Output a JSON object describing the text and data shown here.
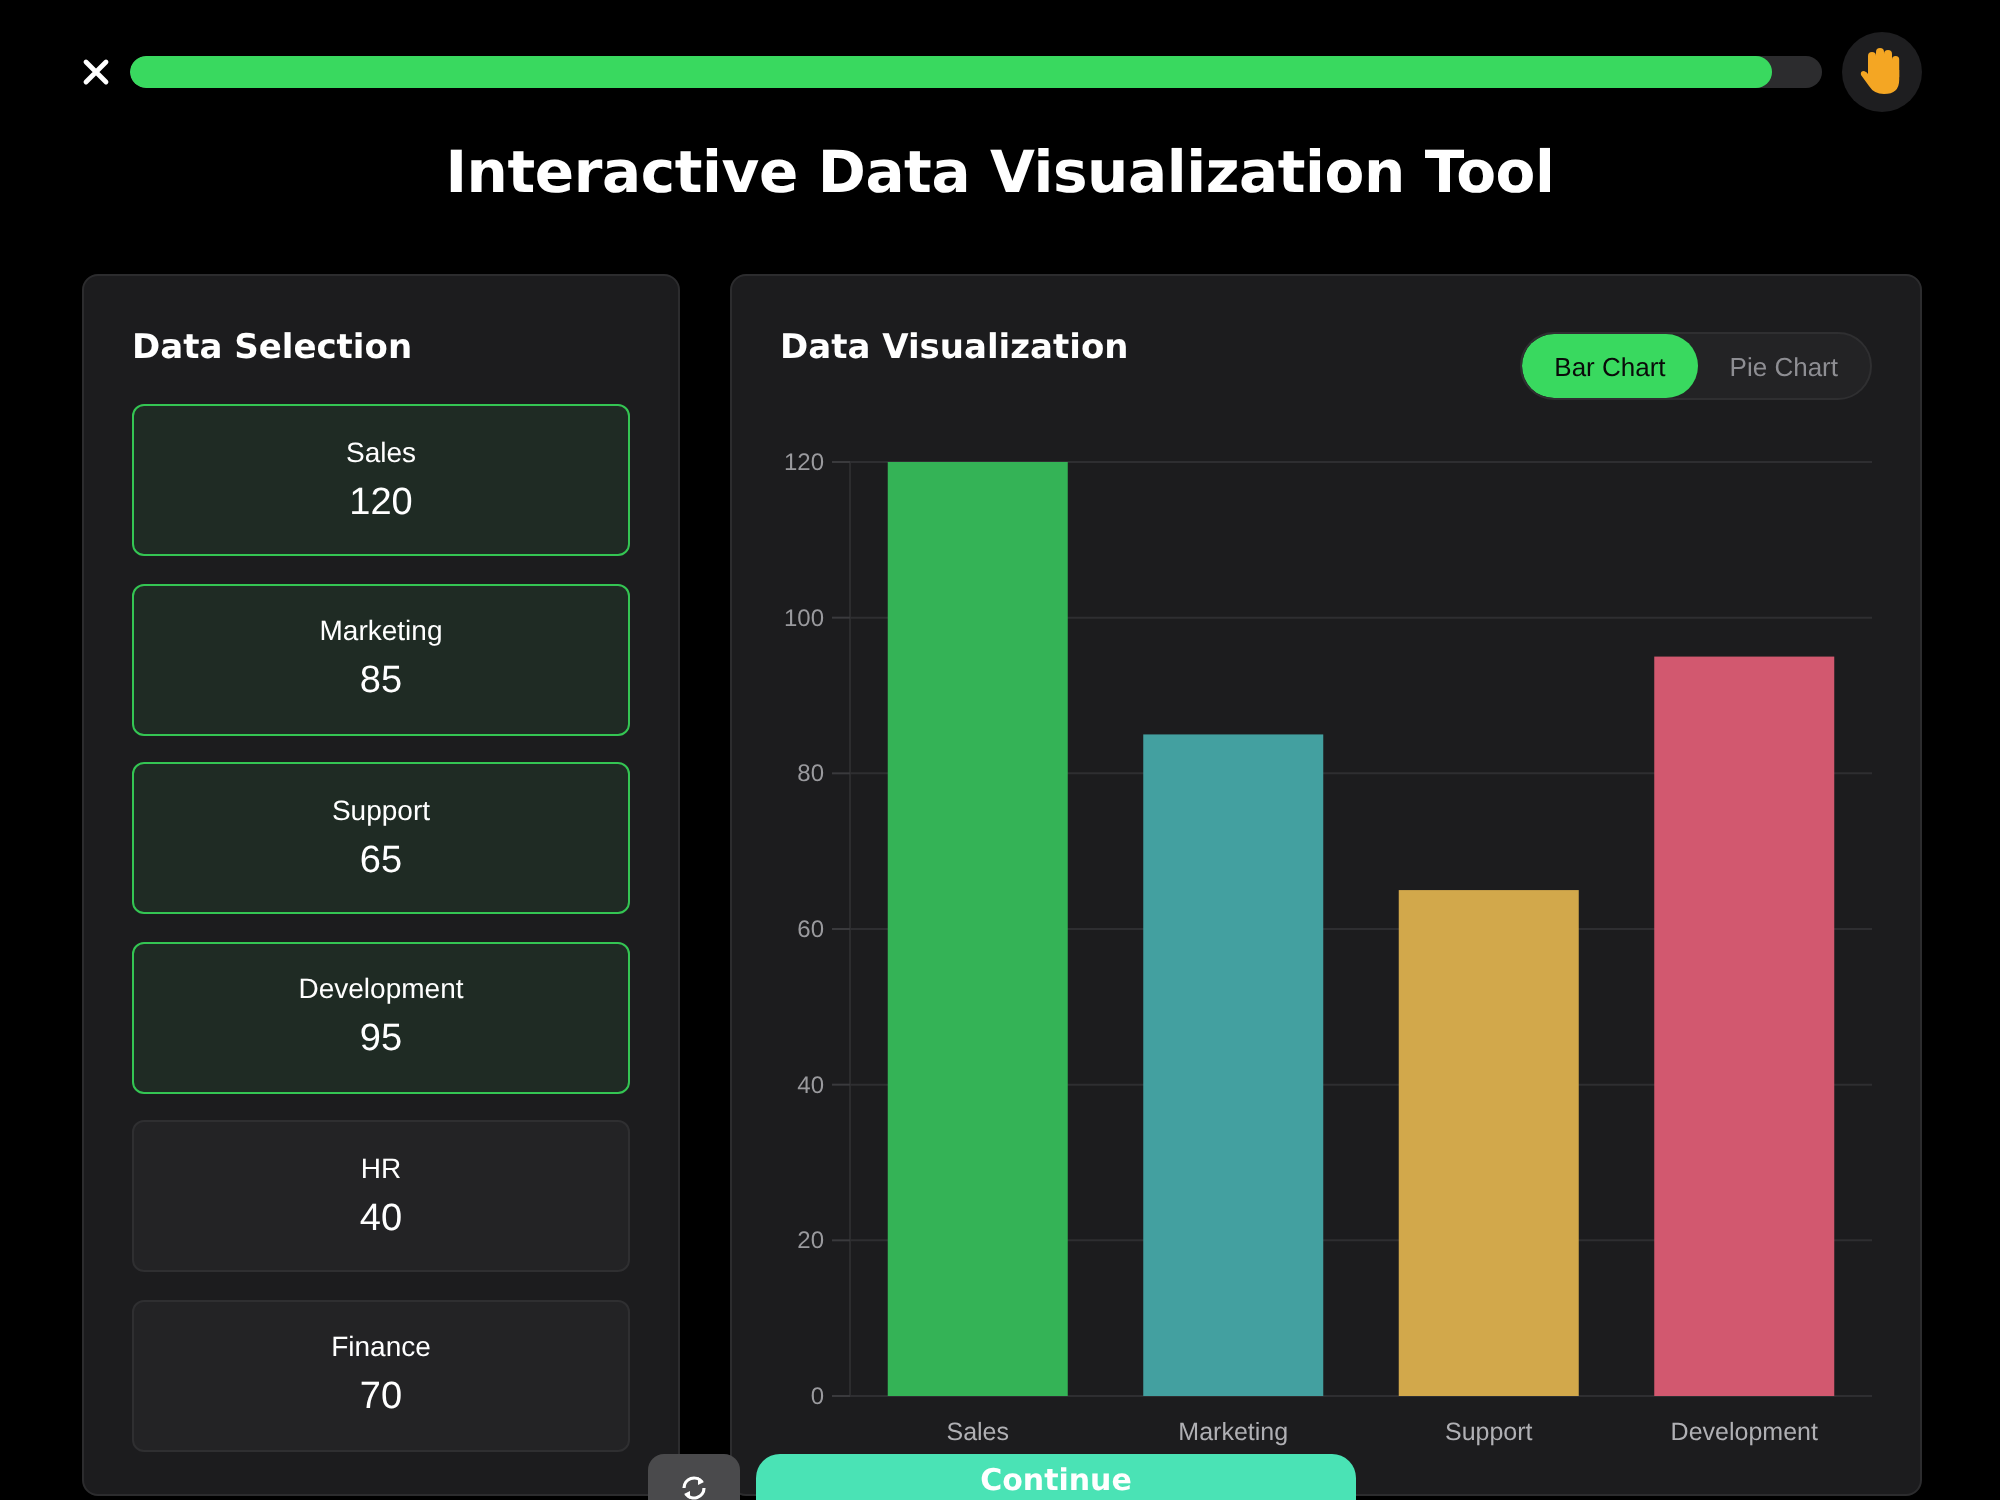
{
  "progress": {
    "level": 0.97
  },
  "title": "Interactive Data Visualization Tool",
  "selection_panel": {
    "title": "Data Selection",
    "items": [
      {
        "label": "Sales",
        "value": "120",
        "selected": true
      },
      {
        "label": "Marketing",
        "value": "85",
        "selected": true
      },
      {
        "label": "Support",
        "value": "65",
        "selected": true
      },
      {
        "label": "Development",
        "value": "95",
        "selected": true
      },
      {
        "label": "HR",
        "value": "40",
        "selected": false
      },
      {
        "label": "Finance",
        "value": "70",
        "selected": false
      }
    ]
  },
  "visualization_panel": {
    "title": "Data Visualization",
    "chart_toggle": [
      {
        "label": "Bar Chart",
        "selected": true
      },
      {
        "label": "Pie Chart",
        "selected": false
      }
    ],
    "chart_data": [
      {
        "type": "bar",
        "categories": [
          "Sales",
          "Marketing",
          "Support",
          "Development"
        ],
        "values": [
          120,
          85,
          65,
          95
        ],
        "colors": [
          "#34b356",
          "#43a0a0",
          "#d2a84b",
          "#d2586f"
        ],
        "ylim": [
          0,
          120
        ],
        "yticks": [
          0,
          20,
          40,
          60,
          80,
          100,
          120
        ],
        "grid": true
      }
    ]
  },
  "continue_button": {
    "label": "Continue"
  }
}
